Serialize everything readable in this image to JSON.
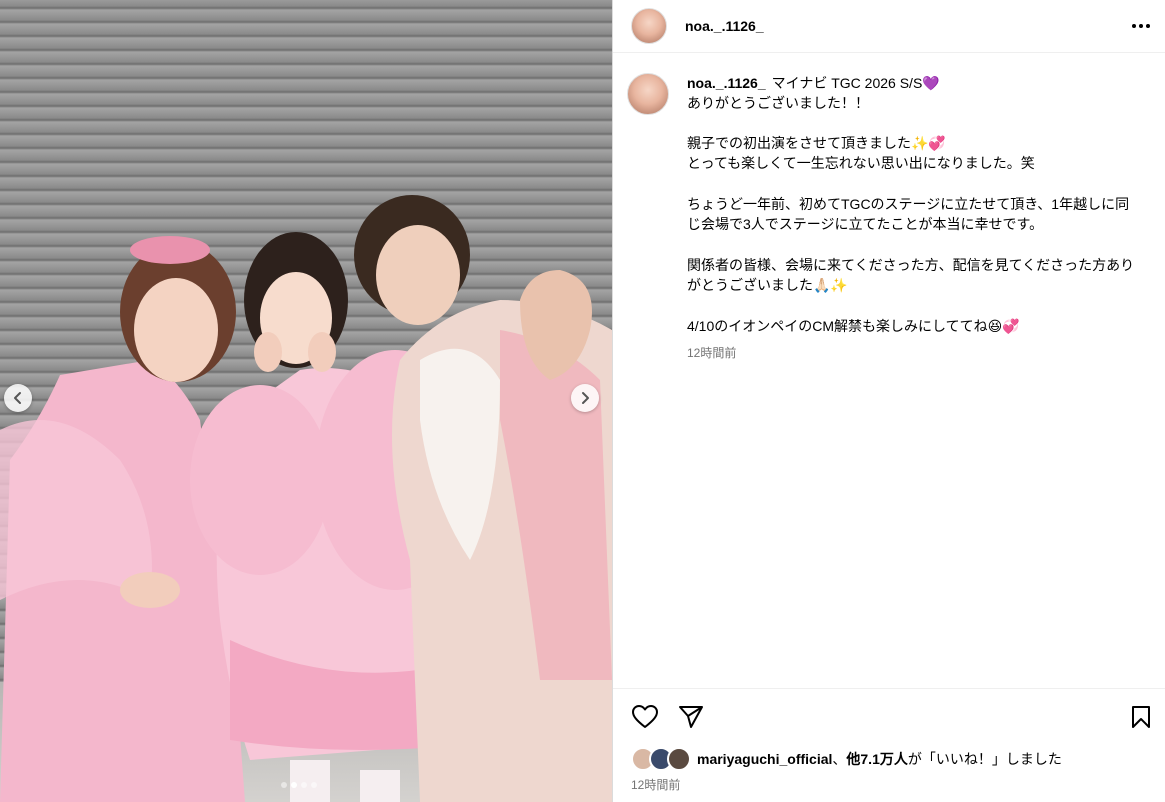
{
  "media": {
    "carousel": {
      "slide_count": 4,
      "active_index": 1
    },
    "prev_icon": "chevron-left-icon",
    "next_icon": "chevron-right-icon"
  },
  "header": {
    "username": "noa._.1126_",
    "more_icon": "more-horizontal-icon"
  },
  "caption": {
    "username": "noa._.1126_",
    "lines": [
      "マイナビ TGC 2026 S/S💜",
      "ありがとうございました！！",
      "親子での初出演をさせて頂きました✨💞",
      "とっても楽しくて一生忘れない思い出になりました。笑",
      "ちょうど一年前、初めてTGCのステージに立たせて頂き、1年越しに同じ会場で3人でステージに立てたことが本当に幸せです。",
      "関係者の皆様、会場に来てくださった方、配信を見てくださった方ありがとうございました🙏🏻✨",
      "4/10のイオンペイのCM解禁も楽しみにしててね😆💞"
    ],
    "time": "12時間前"
  },
  "actions": {
    "like_icon": "heart-icon",
    "share_icon": "send-icon",
    "save_icon": "bookmark-icon"
  },
  "likes": {
    "liker": "mariyaguchi_official",
    "separator": "、",
    "count_text": "他7.1万人",
    "suffix": "が「いいね！」しました"
  },
  "post_time": "12時間前",
  "colors": {
    "secondary_text": "#737373",
    "divider": "#dbdbdb",
    "dress_pink": "#f4b7cc"
  }
}
